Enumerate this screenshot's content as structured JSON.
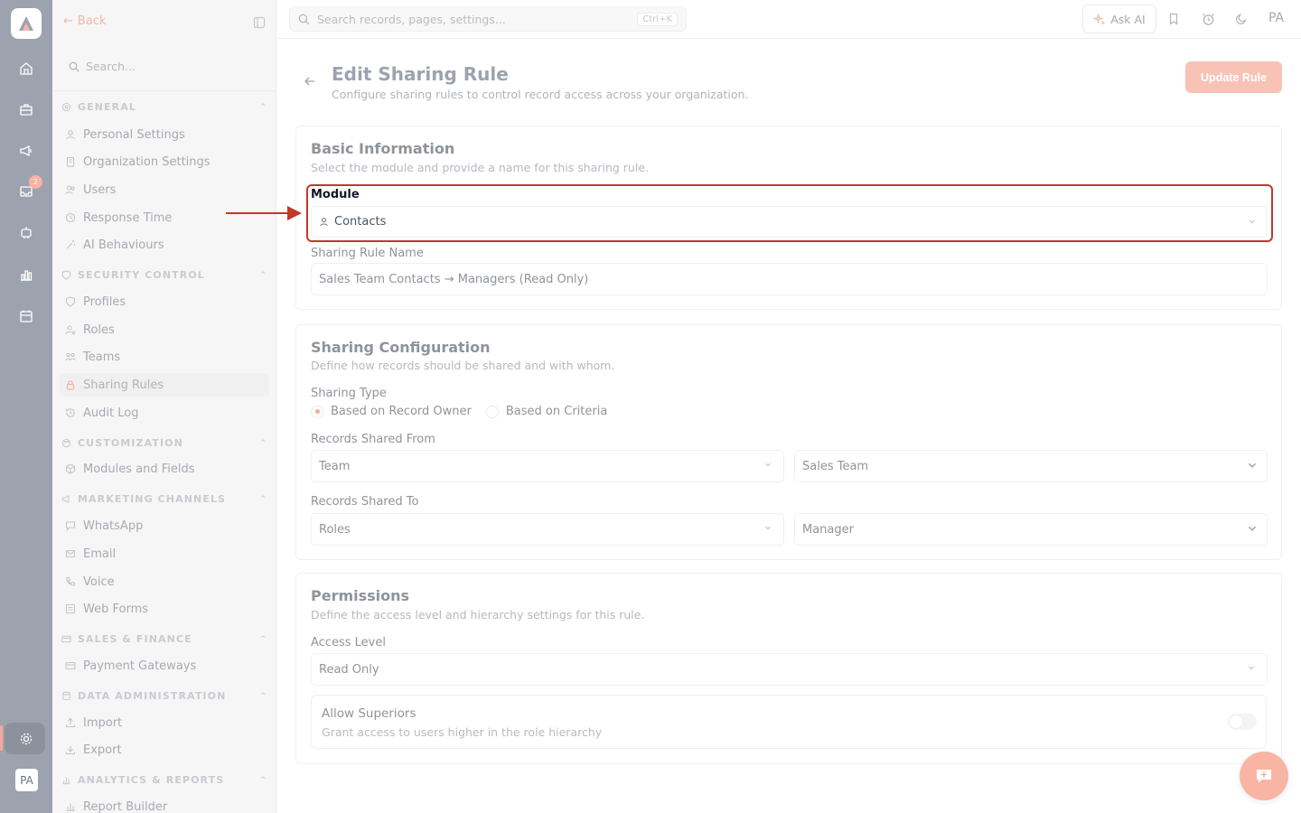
{
  "rail": {
    "badge_count": "2",
    "avatar_initials": "PA"
  },
  "sidebar": {
    "back_label": "Back",
    "search_placeholder": "Search...",
    "sections": [
      {
        "title": "GENERAL",
        "items": [
          "Personal Settings",
          "Organization Settings",
          "Users",
          "Response Time",
          "AI Behaviours"
        ]
      },
      {
        "title": "SECURITY CONTROL",
        "items": [
          "Profiles",
          "Roles",
          "Teams",
          "Sharing Rules",
          "Audit Log"
        ]
      },
      {
        "title": "CUSTOMIZATION",
        "items": [
          "Modules and Fields"
        ]
      },
      {
        "title": "MARKETING CHANNELS",
        "items": [
          "WhatsApp",
          "Email",
          "Voice",
          "Web Forms"
        ]
      },
      {
        "title": "SALES & FINANCE",
        "items": [
          "Payment Gateways"
        ]
      },
      {
        "title": "DATA ADMINISTRATION",
        "items": [
          "Import",
          "Export"
        ]
      },
      {
        "title": "ANALYTICS & REPORTS",
        "items": [
          "Report Builder"
        ]
      }
    ]
  },
  "topbar": {
    "search_placeholder": "Search records, pages, settings...",
    "shortcut": "Ctrl+K",
    "ask_ai": "Ask AI",
    "initials": "PA"
  },
  "page": {
    "title": "Edit Sharing Rule",
    "subtitle": "Configure sharing rules to control record access across your organization.",
    "update_button": "Update Rule"
  },
  "basic": {
    "title": "Basic Information",
    "subtitle": "Select the module and provide a name for this sharing rule.",
    "module_label": "Module",
    "module_value": "Contacts",
    "name_label": "Sharing Rule Name",
    "name_value": "Sales Team Contacts → Managers (Read Only)"
  },
  "config": {
    "title": "Sharing Configuration",
    "subtitle": "Define how records should be shared and with whom.",
    "type_label": "Sharing Type",
    "option_owner": "Based on Record Owner",
    "option_criteria": "Based on Criteria",
    "from_label": "Records Shared From",
    "from_type": "Team",
    "from_value": "Sales Team",
    "to_label": "Records Shared To",
    "to_type": "Roles",
    "to_value": "Manager"
  },
  "permissions": {
    "title": "Permissions",
    "subtitle": "Define the access level and hierarchy settings for this rule.",
    "access_label": "Access Level",
    "access_value": "Read Only",
    "superiors_title": "Allow Superiors",
    "superiors_sub": "Grant access to users higher in the role hierarchy"
  },
  "colors": {
    "accent": "#f8a898",
    "highlight": "#c0392b"
  }
}
